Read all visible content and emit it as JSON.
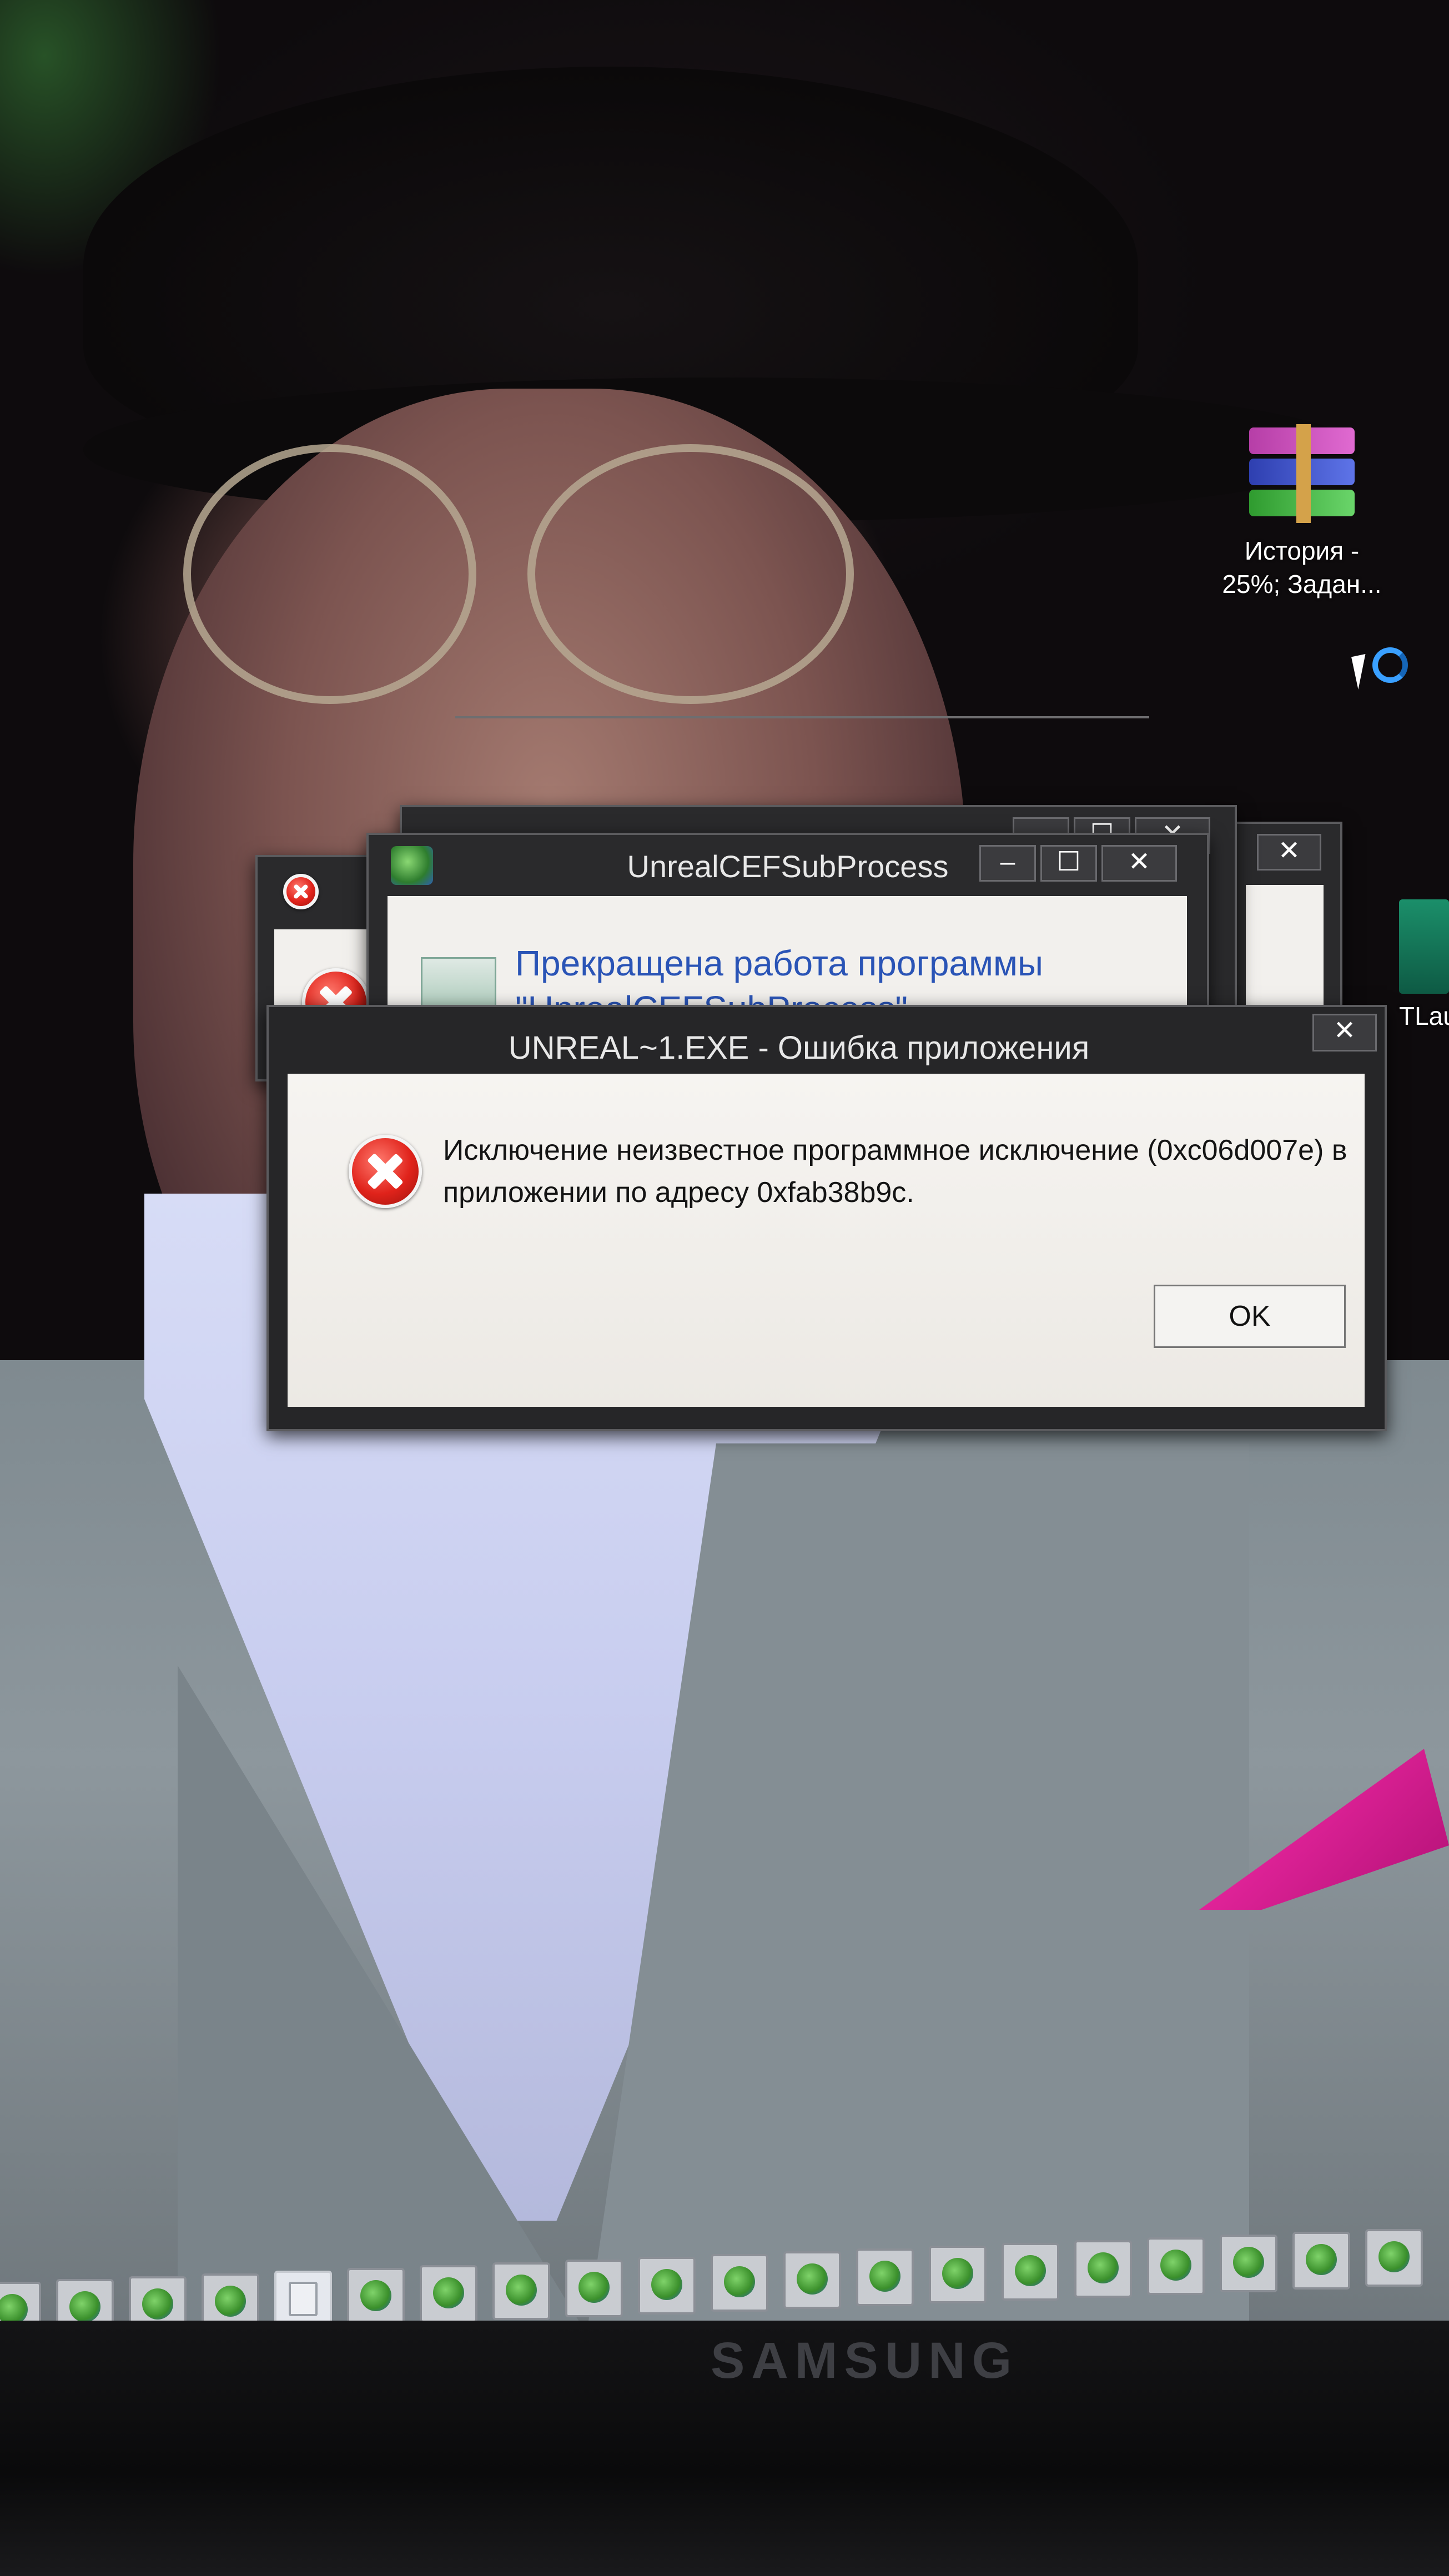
{
  "desktop": {
    "icons": [
      {
        "label": "История -\n25%; Задан..."
      },
      {
        "label": "TLau"
      }
    ]
  },
  "windows": {
    "cef_dialog": {
      "title": "UnrealCEFSubProcess",
      "message_line1": "Прекращена работа программы",
      "message_line2": "\"UnrealCEFSubProcess\""
    },
    "app_error": {
      "title": "UNREAL~1.EXE - Ошибка приложения",
      "message_line1": "Исключение неизвестное программное исключение (0xc06d007e) в",
      "message_line2": "приложении по адресу 0xfab38b9c.",
      "ok_label": "OK"
    },
    "caption": {
      "minimize_glyph": "‒",
      "maximize_glyph": "☐",
      "close_glyph": "✕"
    }
  },
  "taskbar": {
    "active_index": 4,
    "item_count": 20
  },
  "monitor": {
    "brand": "SAMSUNG"
  }
}
